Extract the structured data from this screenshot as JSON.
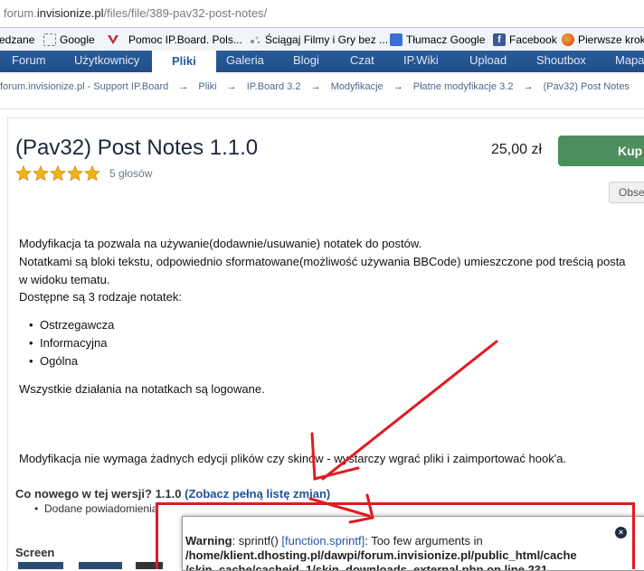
{
  "browser": {
    "url_prefix": "forum.",
    "url_domain": "invisionize.pl",
    "url_path": "/files/file/389-pav32-post-notes/",
    "bookmarks": [
      {
        "label": "edzane",
        "icon": "none"
      },
      {
        "label": "Google",
        "icon": "page-icon"
      },
      {
        "label": "Pomoc IP.Board. Pols...",
        "icon": "ipb-icon"
      },
      {
        "label": "Ściągaj Filmy i Gry bez ...",
        "icon": "sparkle-icon"
      },
      {
        "label": "Tłumacz Google",
        "icon": "translate-icon"
      },
      {
        "label": "Facebook",
        "icon": "facebook-icon"
      },
      {
        "label": "Pierwsze kroki",
        "icon": "firefox-icon"
      }
    ]
  },
  "nav": {
    "tabs": [
      "Forum",
      "Użytkownicy",
      "Pliki",
      "Galeria",
      "Blogi",
      "Czat",
      "IP.Wiki",
      "Upload",
      "Shoutbox",
      "Mapa"
    ],
    "active": "Pliki"
  },
  "breadcrumb": [
    "forum.invisionize.pl - Support IP.Board",
    "Pliki",
    "IP.Board 3.2",
    "Modyfikacje",
    "Płatne modyfikacje 3.2",
    "(Pav32) Post Notes"
  ],
  "breadcrumb_separator": "→",
  "file": {
    "title": "(Pav32) Post Notes 1.1.0",
    "rating_stars": 5,
    "votes": "5 głosów",
    "price": "25,00 zł",
    "buy_label": "Kup",
    "follow_label": "Obse"
  },
  "description": {
    "p1": "Modyfikacja ta pozwala na używanie(dodawnie/usuwanie) notatek do postów.",
    "p2a": "Notatkami są bloki tekstu, odpowiednio sformatowane(możliwość używania BBCode) umieszczone pod treścią posta",
    "p2b": "w widoku tematu.",
    "p3": "Dostępne są 3 rodzaje notatek:",
    "types": [
      "Ostrzegawcza",
      "Informacyjna",
      "Ogólna"
    ],
    "p4": "Wszystkie działania na notatkach są logowane.",
    "p5": "Modyfikacja nie wymaga żadnych edycji plików czy skinów - wystarczy wgrać pliki i zaimportować hook'a."
  },
  "whatsnew": {
    "heading": "Co nowego w tej wersji? 1.1.0",
    "link": "(Zobacz pełną listę zmian)",
    "item": "Dodane powiadomienia"
  },
  "screens_label": "Screen",
  "warning": {
    "label": "Warning",
    "message_pre": ": sprintf() ",
    "link": "[function.sprintf]",
    "message_post": ": Too few arguments in",
    "path1": "/home/klient.dhosting.pl/dawpi/forum.invisionize.pl/public_html/cache",
    "path2": "/skin_cache/cacheid_1/skin_downloads_external.php on line 231",
    "close": "×"
  },
  "colors": {
    "nav_bg": "#2a5c9b",
    "buy_btn": "#4d8e5e",
    "annotation_red": "#e11b22",
    "link": "#1f5396"
  }
}
